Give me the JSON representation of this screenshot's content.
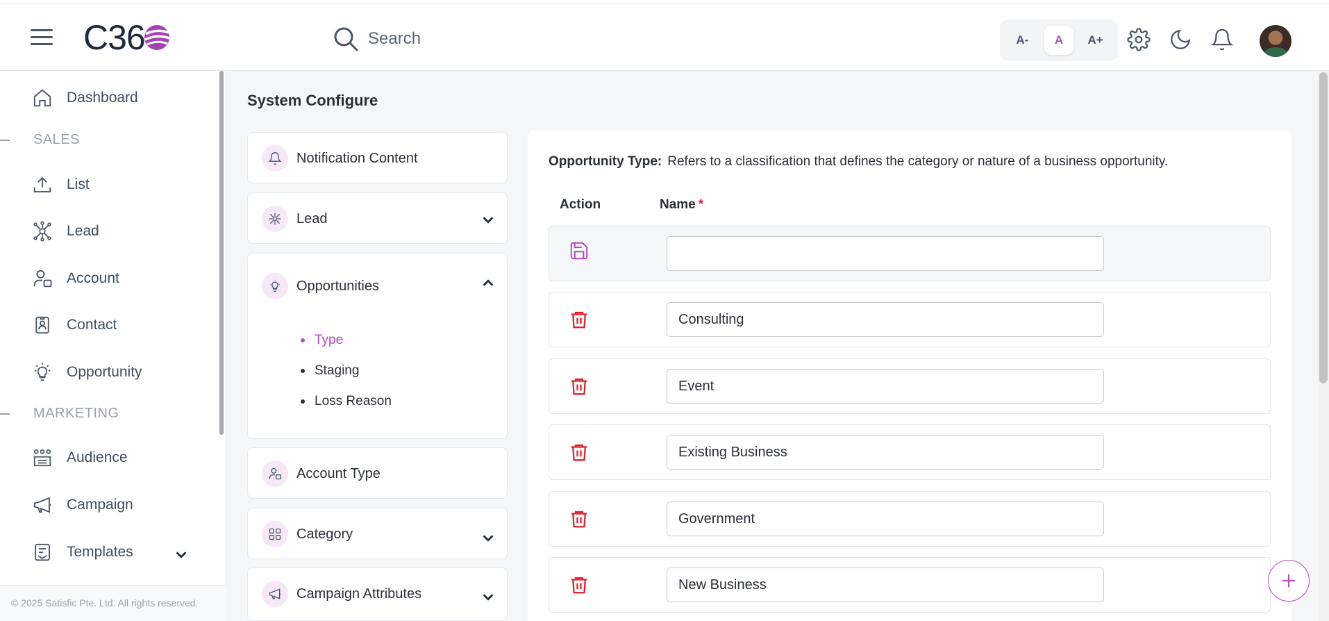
{
  "header": {
    "logo_text": "C36",
    "search_placeholder": "Search",
    "font_size_small": "A-",
    "font_size_default": "A",
    "font_size_large": "A+"
  },
  "sidebar": {
    "items": [
      {
        "label": "Dashboard",
        "icon": "home-icon"
      },
      {
        "section": "SALES"
      },
      {
        "label": "List",
        "icon": "upload-icon"
      },
      {
        "label": "Lead",
        "icon": "network-icon"
      },
      {
        "label": "Account",
        "icon": "user-account-icon"
      },
      {
        "label": "Contact",
        "icon": "contact-card-icon"
      },
      {
        "label": "Opportunity",
        "icon": "lightbulb-icon"
      },
      {
        "section": "MARKETING"
      },
      {
        "label": "Audience",
        "icon": "group-icon"
      },
      {
        "label": "Campaign",
        "icon": "megaphone-icon"
      },
      {
        "label": "Templates",
        "icon": "template-icon"
      }
    ],
    "footer": "© 2025 Satisfic Pte. Ltd. All rights reserved."
  },
  "page": {
    "title": "System Configure"
  },
  "config_menu": {
    "notification": "Notification Content",
    "lead": "Lead",
    "opportunities": "Opportunities",
    "opportunities_sub": [
      "Type",
      "Staging",
      "Loss Reason"
    ],
    "account_type": "Account Type",
    "category": "Category",
    "campaign_attributes": "Campaign Attributes"
  },
  "panel": {
    "desc_label": "Opportunity Type:",
    "desc_text": "Refers to a classification that defines the category or nature of a business opportunity.",
    "col_action": "Action",
    "col_name": "Name",
    "required_mark": "*",
    "new_value": "",
    "rows": [
      "Consulting",
      "Event",
      "Existing Business",
      "Government",
      "New Business"
    ]
  },
  "colors": {
    "accent": "#b34bc1",
    "delete": "#e11d2a"
  }
}
